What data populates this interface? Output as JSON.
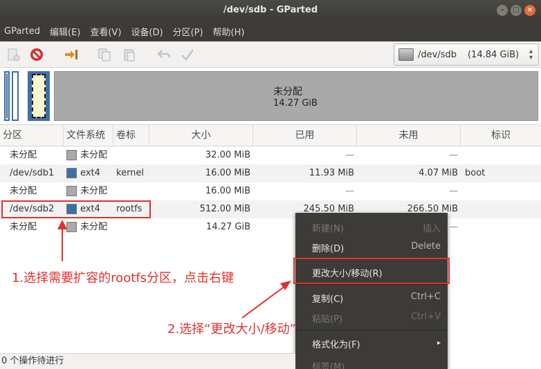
{
  "window": {
    "title": "/dev/sdb - GParted"
  },
  "menubar": [
    "GParted",
    "编辑(E)",
    "查看(V)",
    "设备(D)",
    "分区(P)",
    "帮助(H)"
  ],
  "toolbar": {
    "icons": [
      "new-icon",
      "delete-icon",
      "resize-icon",
      "copy-icon",
      "paste-icon",
      "undo-icon",
      "apply-icon"
    ],
    "device": {
      "name": "/dev/sdb",
      "size": "(14.84 GiB)"
    }
  },
  "graph": {
    "unallocated_label": "未分配",
    "unallocated_size": "14.27 GiB"
  },
  "table": {
    "headers": [
      "分区",
      "文件系统",
      "卷标",
      "大小",
      "已用",
      "未用",
      "标识"
    ],
    "rows": [
      {
        "partition": "未分配",
        "fs": "未分配",
        "fs_color": "#a9a9a9",
        "label": "",
        "size": "32.00 MiB",
        "used": "—",
        "unused": "—",
        "flags": ""
      },
      {
        "partition": "/dev/sdb1",
        "fs": "ext4",
        "fs_color": "#3f6fa6",
        "label": "kernel",
        "size": "16.00 MiB",
        "used": "11.93 MiB",
        "unused": "4.07 MiB",
        "flags": "boot"
      },
      {
        "partition": "未分配",
        "fs": "未分配",
        "fs_color": "#a9a9a9",
        "label": "",
        "size": "16.00 MiB",
        "used": "—",
        "unused": "—",
        "flags": ""
      },
      {
        "partition": "/dev/sdb2",
        "fs": "ext4",
        "fs_color": "#3f6fa6",
        "label": "rootfs",
        "size": "512.00 MiB",
        "used": "245.50 MiB",
        "unused": "266.50 MiB",
        "flags": ""
      },
      {
        "partition": "未分配",
        "fs": "未分配",
        "fs_color": "#a9a9a9",
        "label": "",
        "size": "14.27 GiB",
        "used": "—",
        "unused": "—",
        "flags": ""
      }
    ]
  },
  "context_menu": {
    "new": {
      "label": "新建(N)",
      "shortcut": "插入"
    },
    "delete": {
      "label": "删除(D)",
      "shortcut": "Delete"
    },
    "resize": {
      "label": "更改大小/移动(R)"
    },
    "copy": {
      "label": "复制(C)",
      "shortcut": "Ctrl+C"
    },
    "paste": {
      "label": "粘贴(P)",
      "shortcut": "Ctrl+V"
    },
    "format": {
      "label": "格式化为(F)"
    },
    "label_item": {
      "label": "标签(M)"
    }
  },
  "annotations": {
    "step1": "1.选择需要扩容的rootfs分区，点击右键",
    "step2": "2.选择“更改大小/移动”"
  },
  "status": {
    "text": "0 个操作待进行"
  },
  "colors": {
    "accent_red": "#e0312d",
    "ext4": "#3f6fa6",
    "unallocated": "#a9a9a9"
  }
}
